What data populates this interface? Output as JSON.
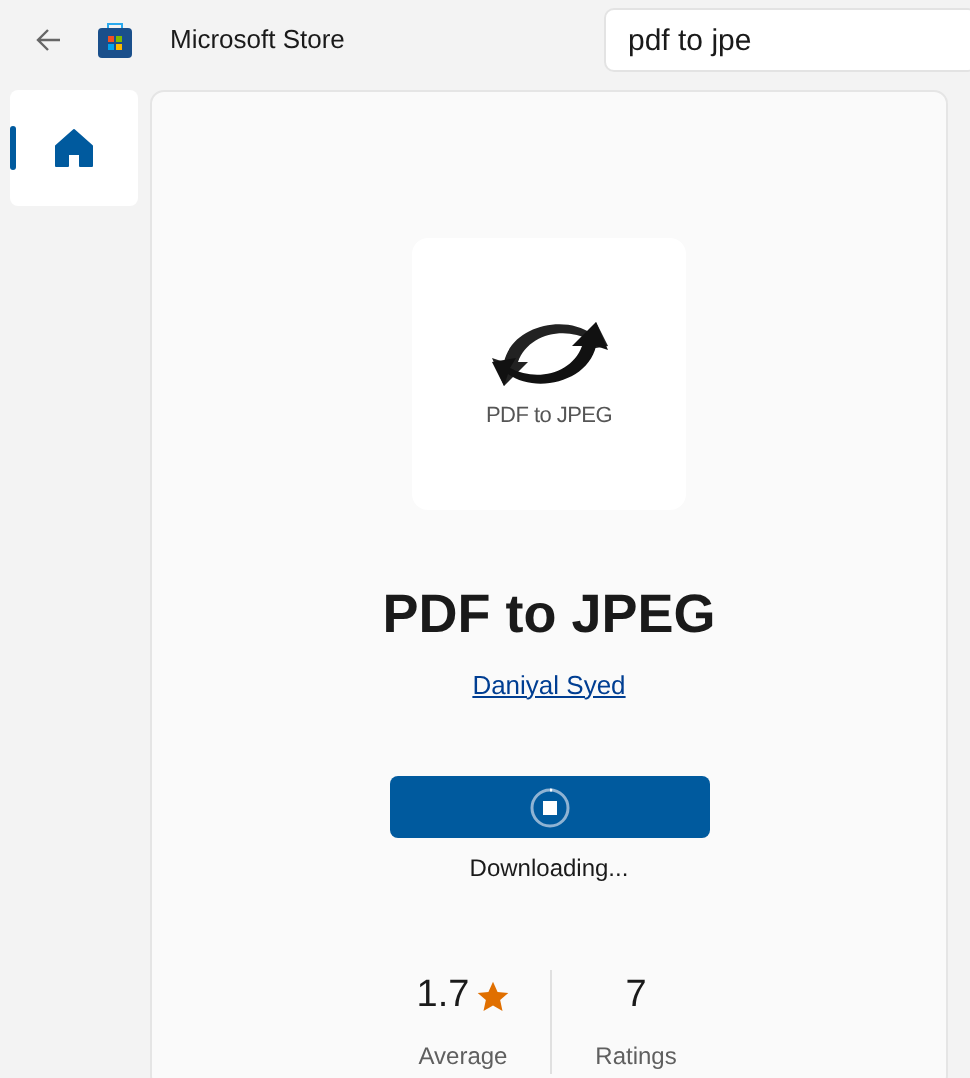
{
  "window": {
    "title": "Microsoft Store"
  },
  "search": {
    "value": "pdf to jpe"
  },
  "sidebar": {
    "items": [
      {
        "kind": "home",
        "selected": true
      }
    ]
  },
  "app": {
    "icon_caption": "PDF to JPEG",
    "name": "PDF to JPEG",
    "publisher": "Daniyal Syed",
    "status": "Downloading...",
    "progress": {
      "level": 0.02
    },
    "stats": [
      {
        "kind": "rating",
        "value": "1.7",
        "label": "Average"
      },
      {
        "kind": "count",
        "value": "7",
        "label": "Ratings"
      }
    ]
  }
}
